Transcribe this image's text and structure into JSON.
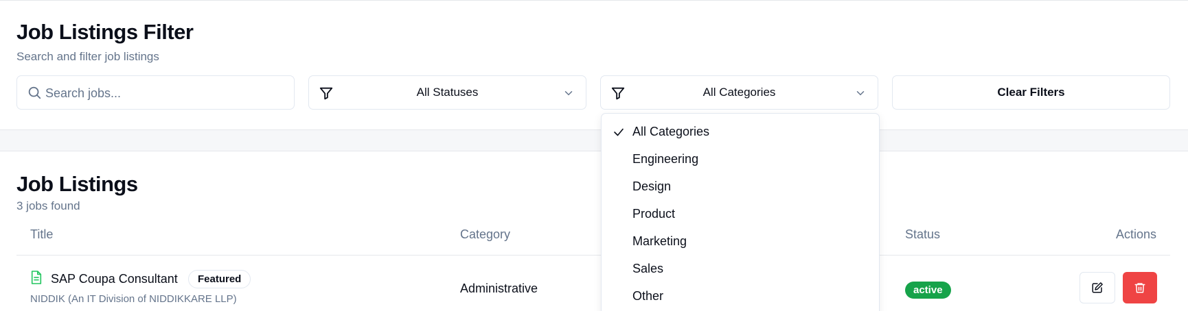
{
  "filter": {
    "title": "Job Listings Filter",
    "subtitle": "Search and filter job listings",
    "search_placeholder": "Search jobs...",
    "status_select": "All Statuses",
    "category_select": "All Categories",
    "clear_label": "Clear Filters"
  },
  "category_dropdown": {
    "options": [
      "All Categories",
      "Engineering",
      "Design",
      "Product",
      "Marketing",
      "Sales",
      "Other"
    ],
    "selected": "All Categories"
  },
  "listings": {
    "title": "Job Listings",
    "count_text": "3 jobs found",
    "columns": {
      "title": "Title",
      "category": "Category",
      "status": "Status",
      "actions": "Actions"
    },
    "rows": [
      {
        "title": "SAP Coupa Consultant",
        "badge": "Featured",
        "company": "NIDDIK (An IT Division of NIDDIKKARE LLP)",
        "category": "Administrative",
        "status": "active"
      }
    ]
  },
  "colors": {
    "accent_green": "#16a34a",
    "danger_red": "#ef4444",
    "muted": "#64748b",
    "doc_icon": "#22c55e"
  },
  "icons": {
    "search": "search-icon",
    "filter": "filter-icon",
    "chevron": "chevron-down-icon",
    "check": "check-icon",
    "doc": "file-text-icon",
    "edit": "edit-icon",
    "delete": "trash-icon"
  }
}
